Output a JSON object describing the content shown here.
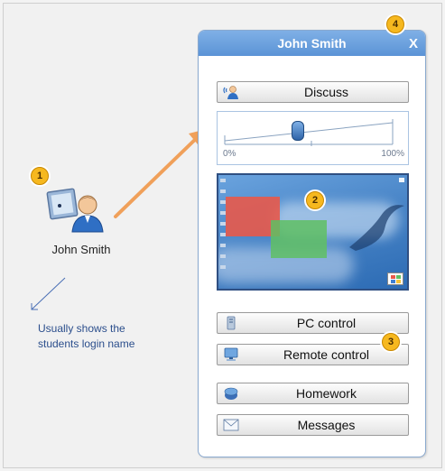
{
  "student": {
    "name": "John Smith"
  },
  "annotation": {
    "text": "Usually shows the students login name"
  },
  "badges": [
    "1",
    "2",
    "3",
    "4"
  ],
  "panel": {
    "title": "John Smith",
    "close_label": "X",
    "discuss_label": "Discuss",
    "slider": {
      "min_label": "0%",
      "max_label": "100%",
      "value_fraction": 0.43
    },
    "buttons": {
      "pc_control": "PC control",
      "remote_control": "Remote control",
      "homework": "Homework",
      "messages": "Messages"
    }
  },
  "colors": {
    "header": "#5b93d6",
    "badge": "#f6b81f",
    "arrow": "#f0a05a",
    "annotation": "#2b4e8c"
  },
  "icons": {
    "student": "student-pc-icon",
    "discuss": "discuss-icon",
    "pc_control": "pc-control-icon",
    "remote_control": "remote-control-icon",
    "homework": "homework-icon",
    "messages": "messages-icon",
    "slider_thumb": "slider-thumb"
  }
}
